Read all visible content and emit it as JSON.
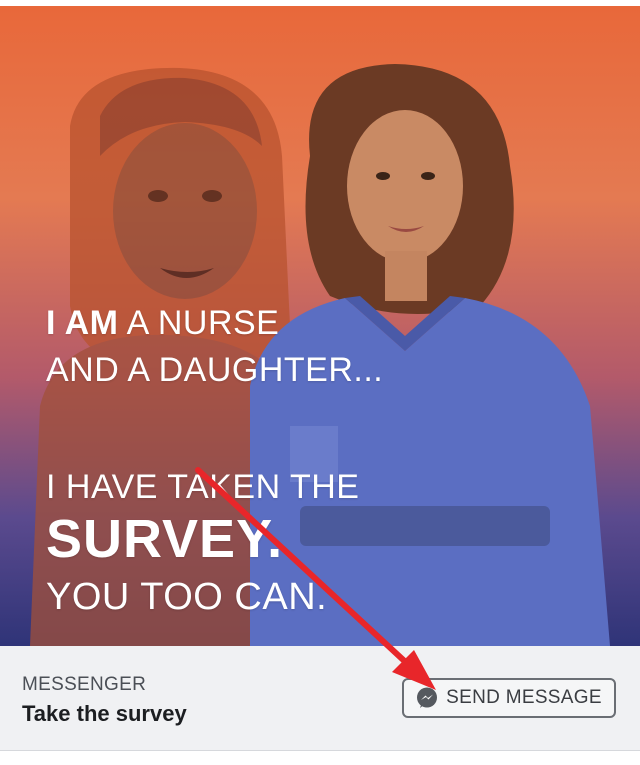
{
  "ad": {
    "headline": {
      "line1_bold": "I AM",
      "line1_rest": " A NURSE",
      "line2": "AND A DAUGHTER...",
      "line3": "I HAVE TAKEN THE",
      "line4": "SURVEY.",
      "line5": "YOU TOO CAN."
    }
  },
  "cta": {
    "source": "MESSENGER",
    "title": "Take the survey",
    "button_label": "SEND MESSAGE",
    "button_icon": "messenger-icon"
  },
  "annotation": {
    "arrow_color": "#e8262a"
  },
  "colors": {
    "cta_background": "#f0f1f3",
    "messenger_icon": "#55595f"
  }
}
